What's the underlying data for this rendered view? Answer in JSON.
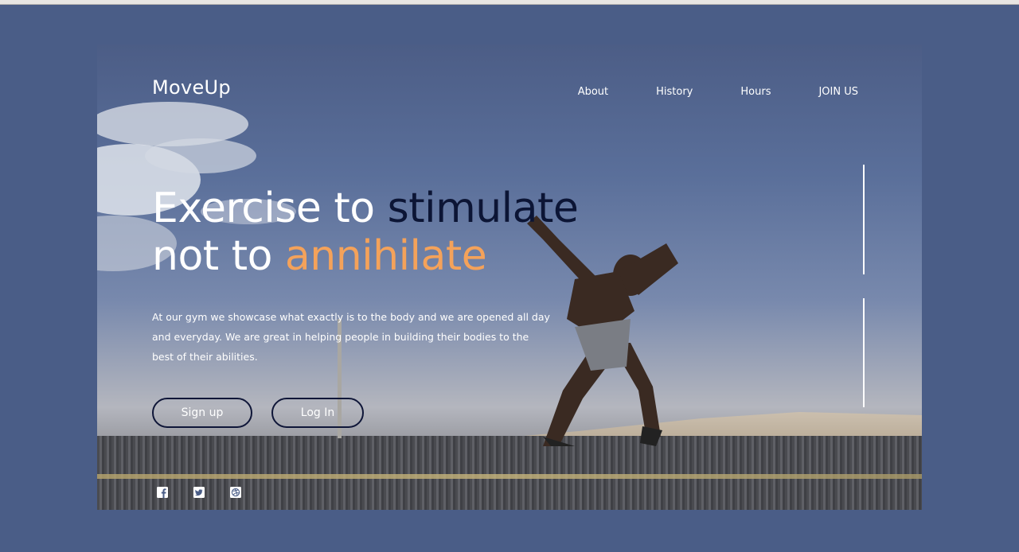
{
  "brand": {
    "logo_text": "MoveUp"
  },
  "nav": {
    "items": [
      "About",
      "History",
      "Hours",
      "JOIN US"
    ]
  },
  "hero": {
    "headline_part1": "Exercise to ",
    "headline_highlight1": "stimulate",
    "headline_part2": "not to ",
    "headline_highlight2": "annihilate",
    "description": "At our gym we showcase what exactly is to the body and we are opened all day and everyday. We are great in helping people in building their bodies to the best of their abilities.",
    "signup_label": "Sign up",
    "login_label": "Log In"
  },
  "social": {
    "icons": [
      "facebook-icon",
      "twitter-icon",
      "dribbble-icon"
    ]
  },
  "colors": {
    "background": "#4a5d87",
    "accent_orange": "#f4a25a",
    "accent_dark": "#0c1535"
  }
}
